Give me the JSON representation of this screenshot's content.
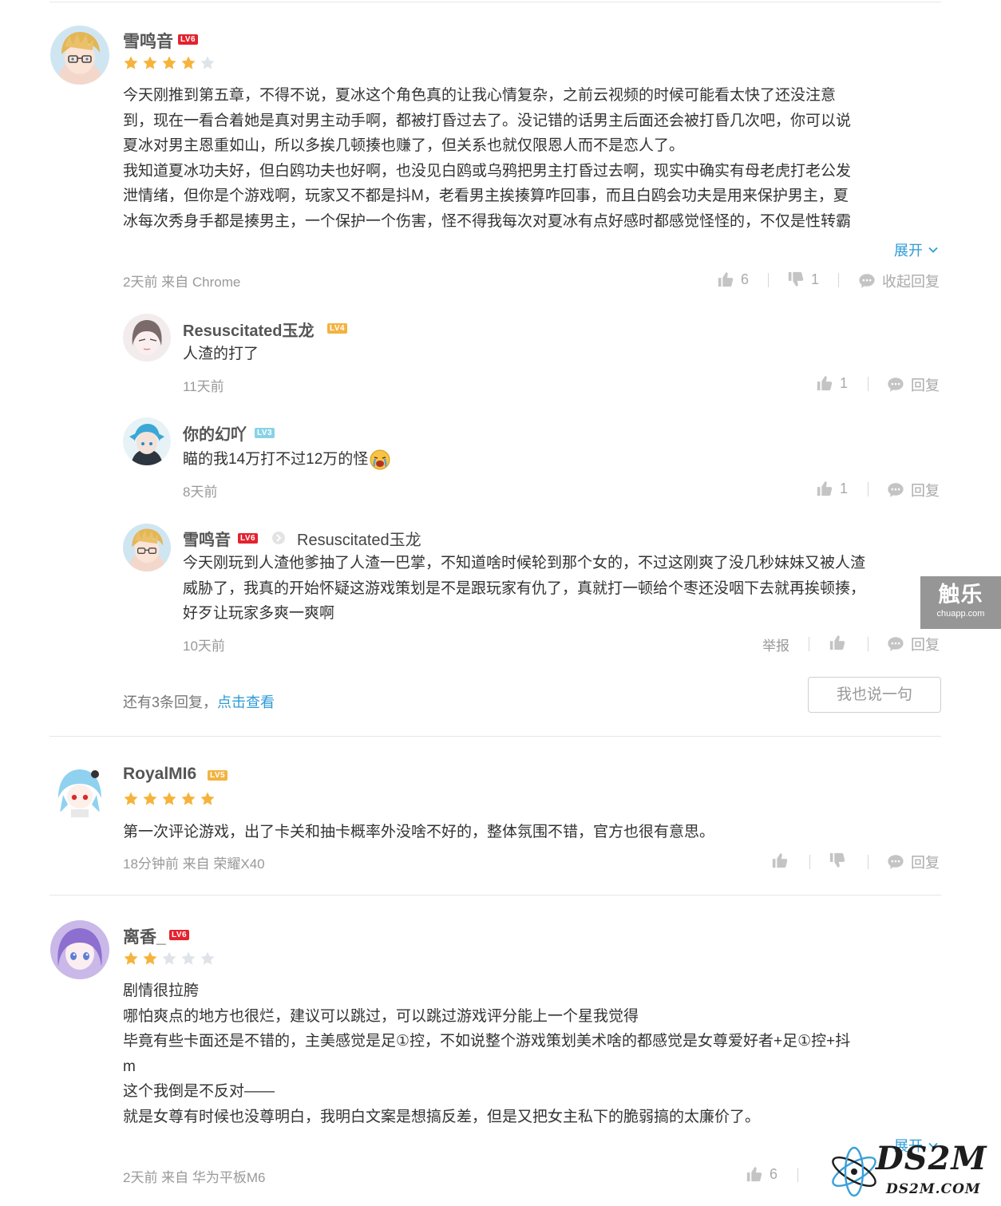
{
  "review1": {
    "username": "雪鸣音",
    "level": "LV6",
    "rating": 4,
    "lines": [
      "今天刚推到第五章，不得不说，夏冰这个角色真的让我心情复杂，之前云视频的时候可能看太快了还没注意",
      "到，现在一看合着她是真对男主动手啊，都被打昏过去了。没记错的话男主后面还会被打昏几次吧，你可以说",
      "夏冰对男主恩重如山，所以多挨几顿揍也赚了，但关系也就仅限恩人而不是恋人了。",
      "我知道夏冰功夫好，但白鸥功夫也好啊，也没见白鸥或乌鸦把男主打昏过去啊，现实中确实有母老虎打老公发",
      "泄情绪，但你是个游戏啊，玩家又不都是抖M，老看男主挨揍算咋回事，而且白鸥会功夫是用来保护男主，夏",
      "冰每次秀身手都是揍男主，一个保护一个伤害，怪不得我每次对夏冰有点好感时都感觉怪怪的，不仅是性转霸"
    ],
    "expand_label": "展开",
    "meta": "2天前 来自 Chrome",
    "like_count": "6",
    "dislike_count": "1",
    "collapse_label": "收起回复"
  },
  "replies": [
    {
      "username": "Resuscitated玉龙",
      "level": "LV4",
      "text": "人渣的打了",
      "time": "11天前",
      "like_count": "1",
      "reply_label": "回复"
    },
    {
      "username": "你的幻吖",
      "level": "LV3",
      "text": "瞄的我14万打不过12万的怪",
      "time": "8天前",
      "like_count": "1",
      "reply_label": "回复"
    },
    {
      "username": "雪鸣音",
      "level": "LV6",
      "reply_to": "Resuscitated玉龙",
      "lines": [
        "今天刚玩到人渣他爹抽了人渣一巴掌，不知道啥时候轮到那个女的，不过这刚爽了没几秒妹妹又被人渣",
        "威胁了，我真的开始怀疑这游戏策划是不是跟玩家有仇了，真就打一顿给个枣还没咽下去就再挨顿揍，",
        "好歹让玩家多爽一爽啊"
      ],
      "time": "10天前",
      "report_label": "举报",
      "reply_label": "回复"
    }
  ],
  "more_replies": {
    "prefix": "还有3条回复，",
    "link": "点击查看"
  },
  "say_button": "我也说一句",
  "review2": {
    "username": "RoyalMI6",
    "level": "LV5",
    "rating": 5,
    "text": "第一次评论游戏，出了卡关和抽卡概率外没啥不好的，整体氛围不错，官方也很有意思。",
    "meta": "18分钟前 来自 荣耀X40",
    "reply_label": "回复"
  },
  "review3": {
    "username": "离香_",
    "level": "LV6",
    "rating": 2,
    "lines": [
      "剧情很拉胯",
      "哪怕爽点的地方也很烂，建议可以跳过，可以跳过游戏评分能上一个星我觉得",
      "毕竟有些卡面还是不错的，主美感觉是足①控，不如说整个游戏策划美术啥的都感觉是女尊爱好者+足①控+抖",
      "m",
      "这个我倒是不反对——",
      "就是女尊有时候也没尊明白，我明白文案是想搞反差，但是又把女主私下的脆弱搞的太廉价了。"
    ],
    "expand_label": "展开",
    "meta": "2天前 来自 华为平板M6",
    "like_count": "6"
  },
  "watermarks": {
    "chule": "触乐",
    "chule_url": "chuapp.com",
    "ds2m": "DS2M",
    "ds2m_url": "DS2M.COM"
  },
  "colors": {
    "link": "#2f9bd6",
    "star": "#f6b33c",
    "star_empty": "#dfe4ea",
    "level_red": "#e3232e"
  }
}
